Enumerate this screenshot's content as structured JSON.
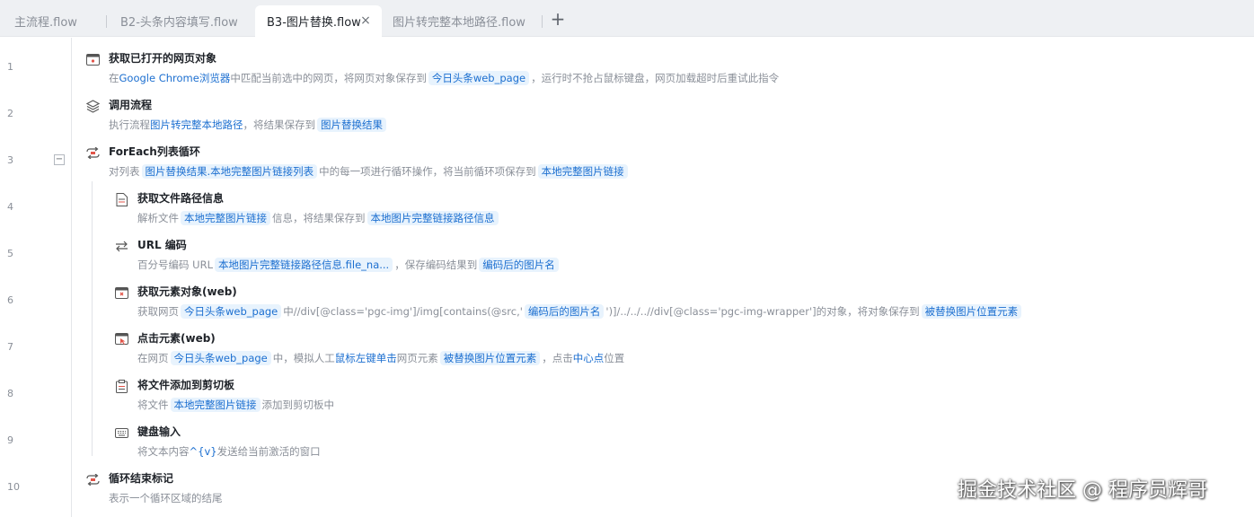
{
  "tabs": [
    {
      "label": "主流程.flow"
    },
    {
      "label": "B2-头条内容填写.flow"
    },
    {
      "label": "B3-图片替换.flow",
      "close": "×"
    },
    {
      "label": "图片转完整本地路径.flow"
    }
  ],
  "add_tab": "+",
  "line_numbers": [
    "1",
    "2",
    "3",
    "4",
    "5",
    "6",
    "7",
    "8",
    "9",
    "10"
  ],
  "fold_toggle": "−",
  "steps": [
    {
      "title": "获取已打开的网页对象",
      "desc": [
        "在",
        "Google Chrome浏览器",
        "中匹配当前选中的网页，将网页对象保存到",
        "今日头条web_page",
        "，运行时不抢占鼠标键盘，网页加载超时后重试此指令"
      ]
    },
    {
      "title": "调用流程",
      "desc": [
        "执行流程",
        "图片转完整本地路径",
        "，将结果保存到",
        "图片替换结果"
      ]
    },
    {
      "title": "ForEach列表循环",
      "desc": [
        "对列表",
        "图片替换结果.本地完整图片链接列表",
        "中的每一项进行循环操作，将当前循环项保存到",
        "本地完整图片链接"
      ]
    },
    {
      "title": "获取文件路径信息",
      "desc": [
        "解析文件",
        "本地完整图片链接",
        "信息，将结果保存到",
        "本地图片完整链接路径信息"
      ]
    },
    {
      "title": "URL 编码",
      "desc": [
        "百分号编码 URL",
        "本地图片完整链接路径信息.file_na...",
        "，保存编码结果到",
        "编码后的图片名"
      ]
    },
    {
      "title": "获取元素对象(web)",
      "desc": [
        "获取网页",
        "今日头条web_page",
        "中//div[@class='pgc-img']/img[contains(@src,'",
        "编码后的图片名",
        "')]/../../..//div[@class='pgc-img-wrapper']的对象，将对象保存到",
        "被替换图片位置元素"
      ]
    },
    {
      "title": "点击元素(web)",
      "desc": [
        "在网页",
        "今日头条web_page",
        "中，模拟人工",
        "鼠标左键单击",
        "网页元素",
        "被替换图片位置元素",
        "，点击",
        "中心点",
        "位置"
      ]
    },
    {
      "title": "将文件添加到剪切板",
      "desc": [
        "将文件",
        "本地完整图片链接",
        "添加到剪切板中"
      ]
    },
    {
      "title": "键盘输入",
      "desc": [
        "将文本内容",
        "^{v}",
        "发送给当前激活的窗口"
      ]
    },
    {
      "title": "循环结束标记",
      "desc": [
        "表示一个循环区域的结尾"
      ]
    }
  ],
  "watermark": "掘金技术社区 @ 程序员辉哥",
  "colors": {
    "accent": "#1c6fd0",
    "variable_bg": "#e8f3fd",
    "tabbar_bg": "#eef0f3"
  }
}
